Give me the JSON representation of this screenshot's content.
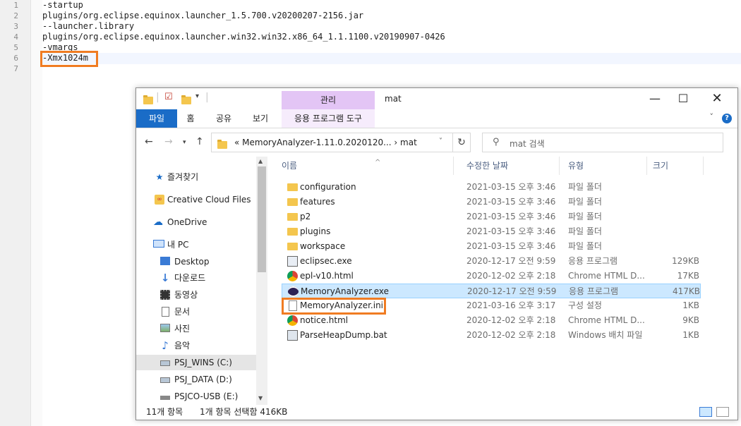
{
  "editor": {
    "lines": [
      {
        "num": "1",
        "text": "-startup"
      },
      {
        "num": "2",
        "text": "plugins/org.eclipse.equinox.launcher_1.5.700.v20200207-2156.jar"
      },
      {
        "num": "3",
        "text": "--launcher.library"
      },
      {
        "num": "4",
        "text": "plugins/org.eclipse.equinox.launcher.win32.win32.x86_64_1.1.1100.v20190907-0426"
      },
      {
        "num": "5",
        "text": "-vmargs"
      },
      {
        "num": "6",
        "text": "-Xmx1024m"
      },
      {
        "num": "7",
        "text": ""
      }
    ],
    "highlight_color": "#f07c22"
  },
  "explorer": {
    "title": "mat",
    "context_tab": "관리",
    "ribbon_tabs": [
      "파일",
      "홈",
      "공유",
      "보기",
      "응용 프로그램 도구"
    ],
    "address": "« MemoryAnalyzer-1.11.0.2020120...  ›  mat",
    "search_placeholder": "mat 검색",
    "nav_items": [
      {
        "label": "즐겨찾기",
        "icon": "star-icon"
      },
      {
        "label": "Creative Cloud Files",
        "icon": "creative-cloud-icon"
      },
      {
        "label": "OneDrive",
        "icon": "cloud-icon"
      },
      {
        "label": "내 PC",
        "icon": "computer-icon"
      },
      {
        "label": "Desktop",
        "icon": "desktop-icon"
      },
      {
        "label": "다운로드",
        "icon": "download-icon"
      },
      {
        "label": "동영상",
        "icon": "video-icon"
      },
      {
        "label": "문서",
        "icon": "document-icon"
      },
      {
        "label": "사진",
        "icon": "picture-icon"
      },
      {
        "label": "음악",
        "icon": "music-icon"
      },
      {
        "label": "PSJ_WINS (C:)",
        "icon": "drive-icon"
      },
      {
        "label": "PSJ_DATA (D:)",
        "icon": "drive-icon"
      },
      {
        "label": "PSJCO-USB (E:)",
        "icon": "usb-drive-icon"
      }
    ],
    "columns": [
      "이름",
      "수정한 날짜",
      "유형",
      "크기"
    ],
    "files": [
      {
        "name": "configuration",
        "date": "2021-03-15 오후 3:46",
        "type": "파일 폴더",
        "size": "",
        "icon": "folder"
      },
      {
        "name": "features",
        "date": "2021-03-15 오후 3:46",
        "type": "파일 폴더",
        "size": "",
        "icon": "folder"
      },
      {
        "name": "p2",
        "date": "2021-03-15 오후 3:46",
        "type": "파일 폴더",
        "size": "",
        "icon": "folder"
      },
      {
        "name": "plugins",
        "date": "2021-03-15 오후 3:46",
        "type": "파일 폴더",
        "size": "",
        "icon": "folder"
      },
      {
        "name": "workspace",
        "date": "2021-03-15 오후 3:46",
        "type": "파일 폴더",
        "size": "",
        "icon": "folder"
      },
      {
        "name": "eclipsec.exe",
        "date": "2020-12-17 오전 9:59",
        "type": "응용 프로그램",
        "size": "129KB",
        "icon": "exe"
      },
      {
        "name": "epl-v10.html",
        "date": "2020-12-02 오후 2:18",
        "type": "Chrome HTML D...",
        "size": "17KB",
        "icon": "chrome"
      },
      {
        "name": "MemoryAnalyzer.exe",
        "date": "2020-12-17 오전 9:59",
        "type": "응용 프로그램",
        "size": "417KB",
        "icon": "eclipse"
      },
      {
        "name": "MemoryAnalyzer.ini",
        "date": "2021-03-16 오후 3:17",
        "type": "구성 설정",
        "size": "1KB",
        "icon": "ini"
      },
      {
        "name": "notice.html",
        "date": "2020-12-02 오후 2:18",
        "type": "Chrome HTML D...",
        "size": "9KB",
        "icon": "chrome"
      },
      {
        "name": "ParseHeapDump.bat",
        "date": "2020-12-02 오후 2:18",
        "type": "Windows 배치 파일",
        "size": "1KB",
        "icon": "bat"
      }
    ],
    "status": {
      "count": "11개 항목",
      "selection": "1개 항목 선택함 416KB"
    },
    "colors": {
      "accent": "#1a6cc7",
      "context_tab": "#e3c5f5",
      "selection": "#cce8ff"
    }
  }
}
